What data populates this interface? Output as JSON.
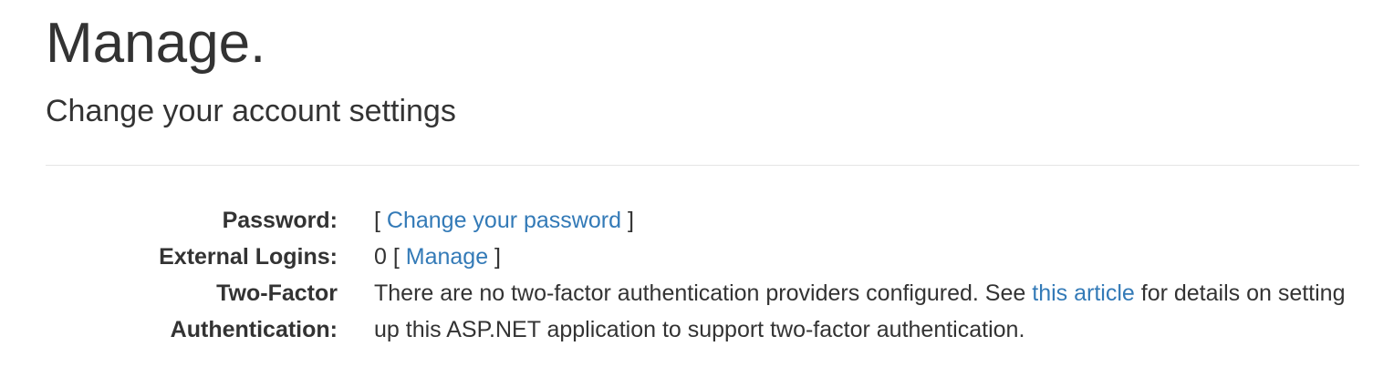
{
  "header": {
    "title": "Manage.",
    "subtitle": "Change your account settings"
  },
  "settings": {
    "password": {
      "label": "Password:",
      "open_bracket": "[ ",
      "link_text": "Change your password",
      "close_bracket": " ]"
    },
    "external_logins": {
      "label": "External Logins:",
      "count": "0",
      "open_bracket": " [ ",
      "link_text": "Manage",
      "close_bracket": " ]"
    },
    "two_factor": {
      "label_line1": "Two-Factor",
      "label_line2": "Authentication:",
      "text_before_link": "There are no two-factor authentication providers configured. See ",
      "link_text": "this article",
      "text_after_link": " for details on setting up this ASP.NET application to support two-factor authentication."
    }
  },
  "colors": {
    "text": "#333333",
    "link": "#337ab7",
    "divider": "#e5e5e5",
    "background": "#ffffff"
  }
}
